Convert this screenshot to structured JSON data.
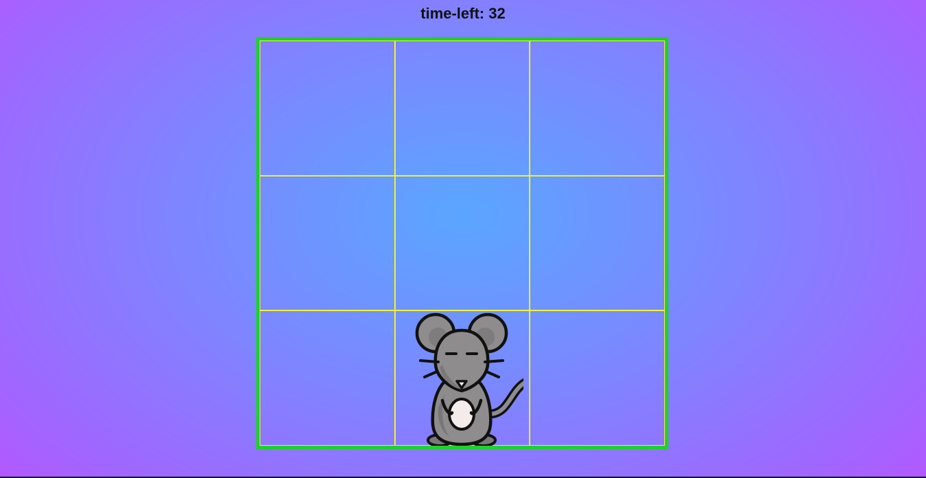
{
  "hud": {
    "time_left_label": "time-left: 32"
  },
  "board": {
    "rows": 3,
    "cols": 3,
    "mouse_cell": 7,
    "border_color": "#1fd12a",
    "grid_line_color": "#f4f03a"
  },
  "character": {
    "icon": "mouse-icon",
    "body_color": "#8e8c8c",
    "belly_color": "#f3ece8"
  }
}
